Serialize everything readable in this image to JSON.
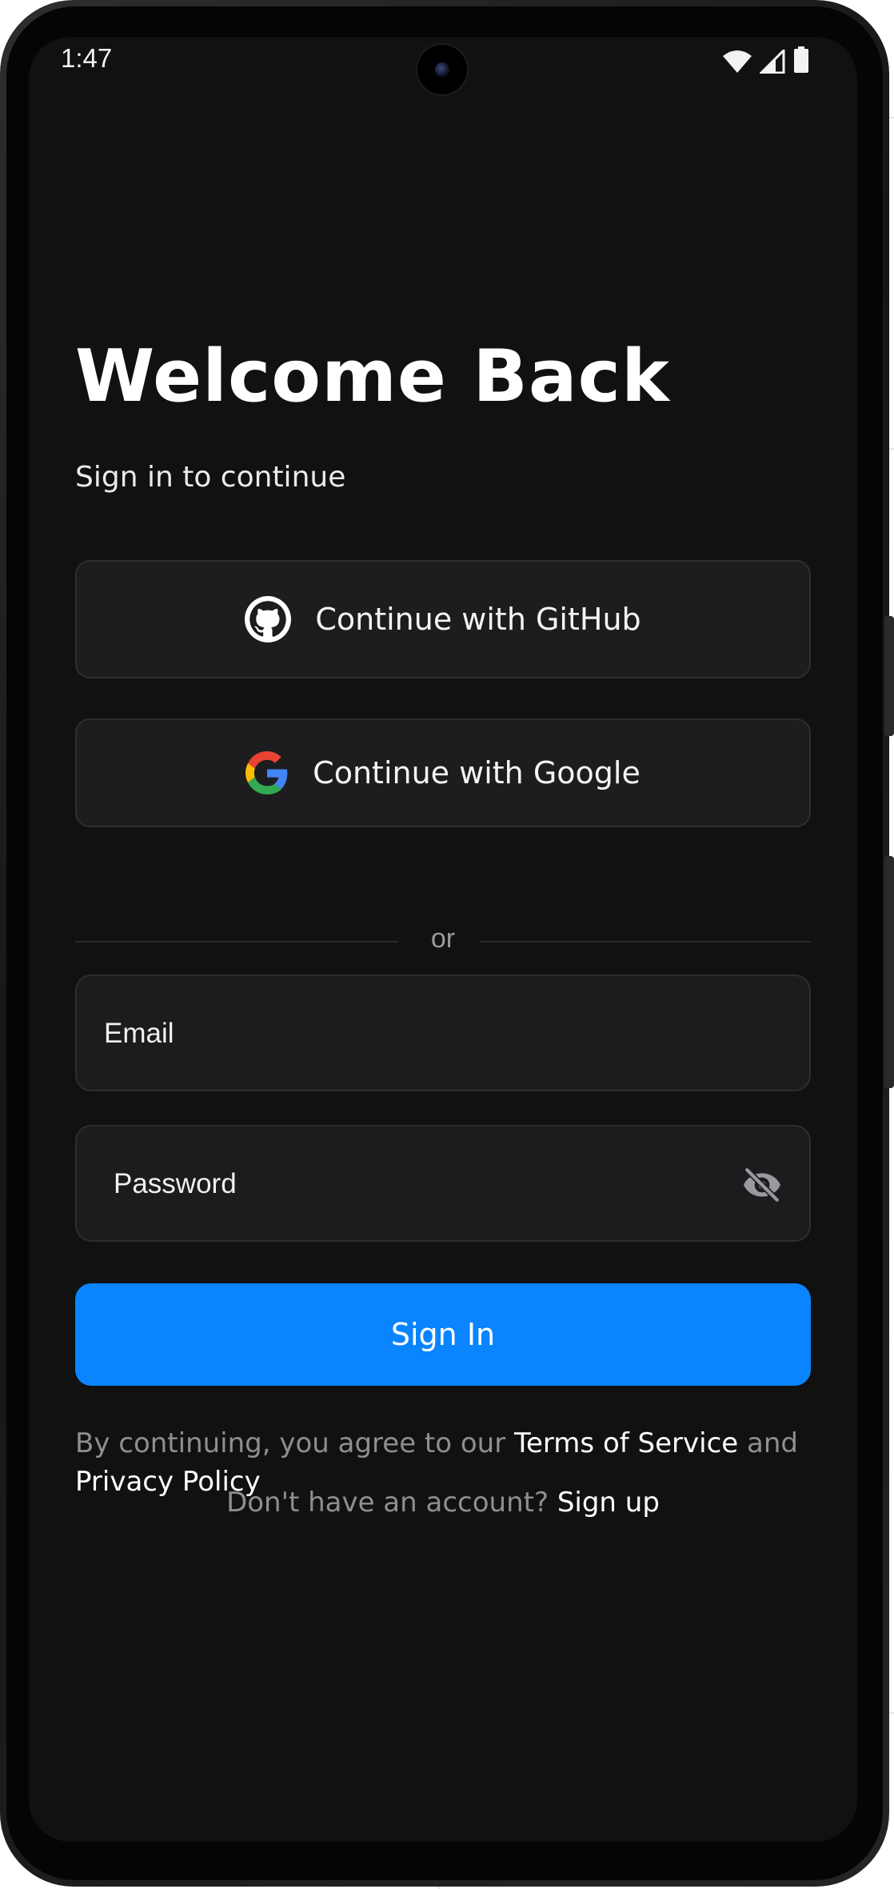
{
  "status_bar": {
    "time": "1:47",
    "icons": [
      "wifi-icon",
      "cell-signal-icon",
      "battery-icon"
    ]
  },
  "header": {
    "title": "Welcome Back",
    "subtitle": "Sign in to continue"
  },
  "oauth": {
    "github_label": "Continue with GitHub",
    "google_label": "Continue with Google"
  },
  "divider": {
    "label": "or"
  },
  "form": {
    "email_placeholder": "Email",
    "password_placeholder": "Password",
    "password_toggle_icon": "eye-off-icon",
    "submit_label": "Sign In"
  },
  "legal": {
    "prefix": "By continuing, you agree to our ",
    "terms_link": "Terms of Service",
    "middle": " and ",
    "privacy_link": "Privacy Policy"
  },
  "signup": {
    "prompt": "Don't have an account? ",
    "link": "Sign up"
  },
  "colors": {
    "background": "#111111",
    "surface": "#1d1d1f",
    "primary": "#0a84ff",
    "muted_text": "#8e8e93"
  }
}
